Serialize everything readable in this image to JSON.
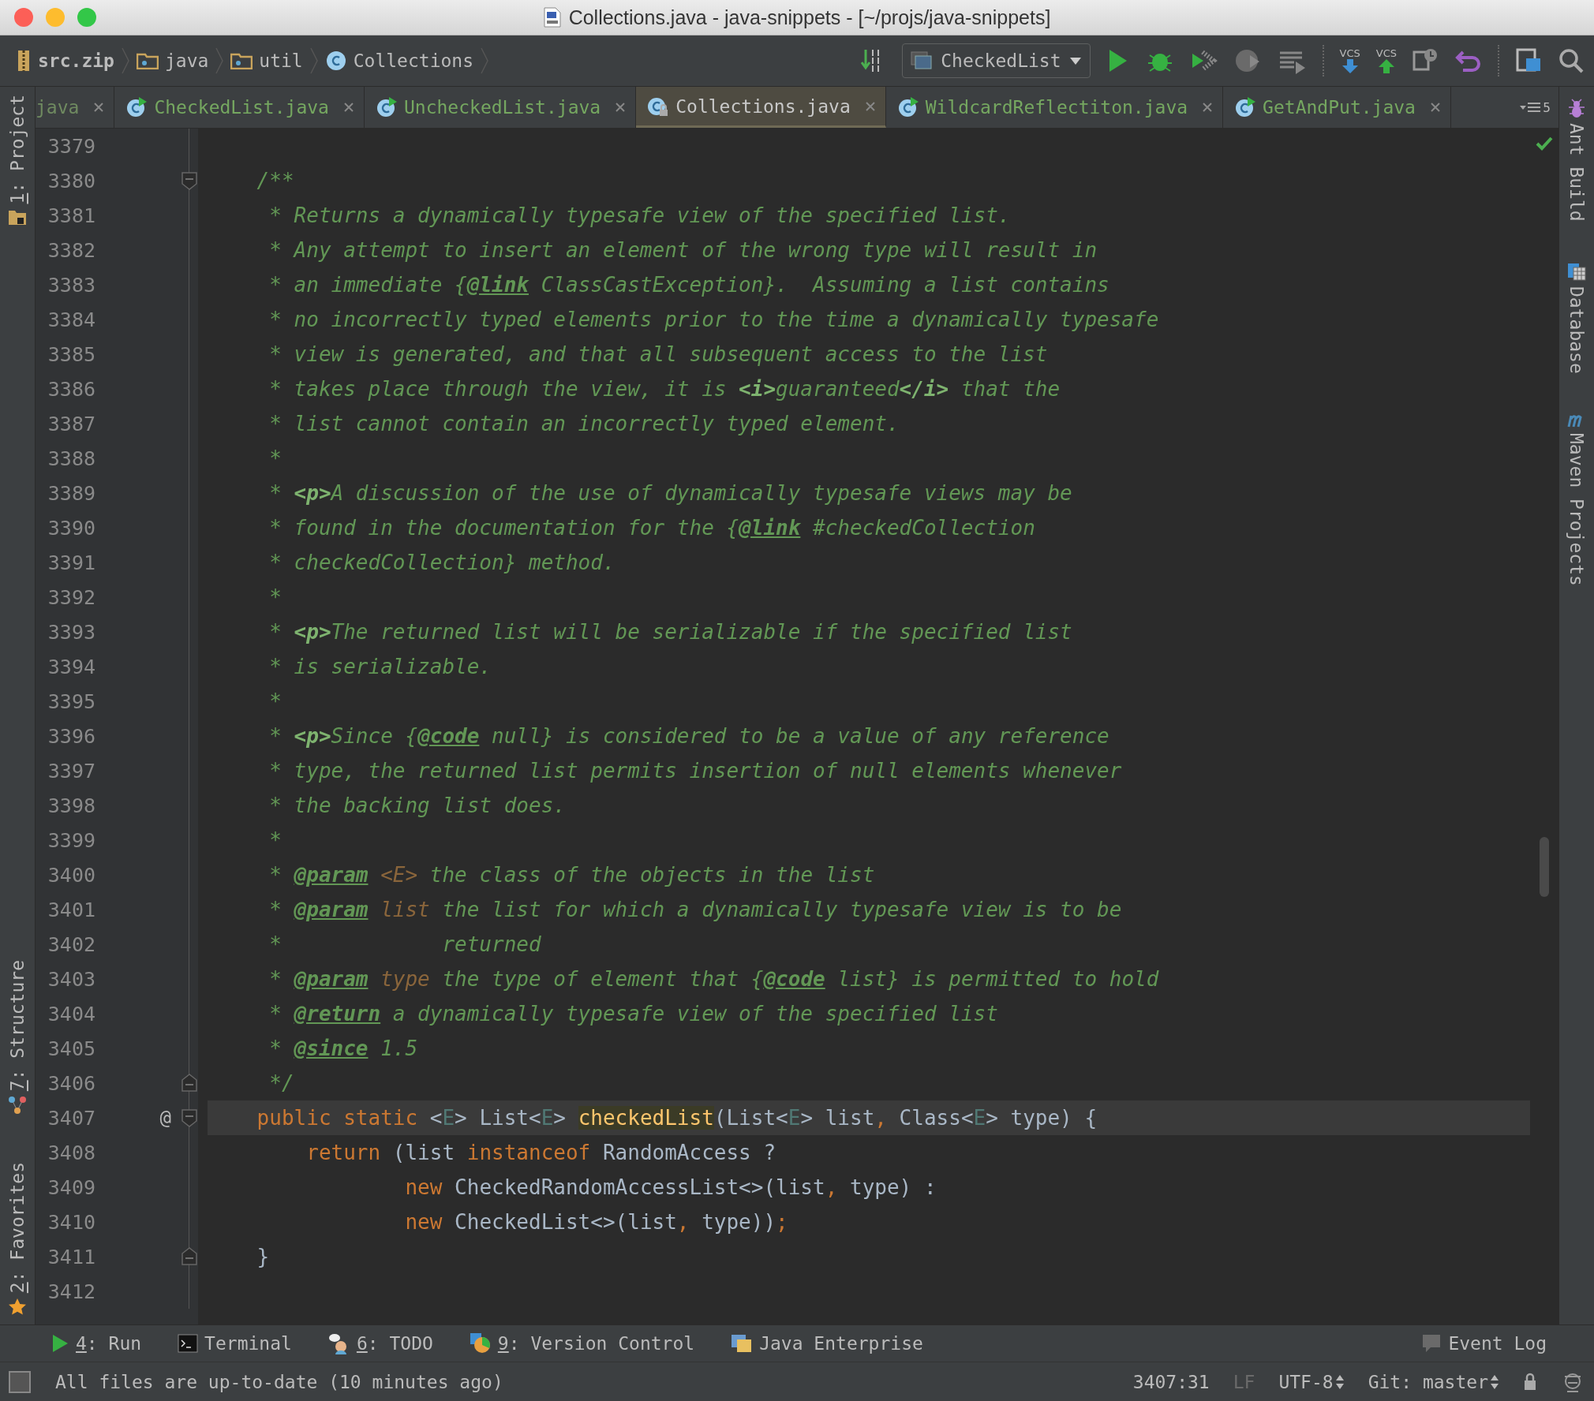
{
  "window": {
    "title": "Collections.java - java-snippets - [~/projs/java-snippets]"
  },
  "breadcrumbs": [
    {
      "label": "src.zip",
      "kind": "archive"
    },
    {
      "label": "java",
      "kind": "folder"
    },
    {
      "label": "util",
      "kind": "folder"
    },
    {
      "label": "Collections",
      "kind": "class"
    }
  ],
  "toolbar": {
    "run_config": "CheckedList",
    "vcs_buttons": [
      {
        "label": "VCS",
        "kind": "update"
      },
      {
        "label": "VCS",
        "kind": "commit"
      }
    ]
  },
  "tabs": [
    {
      "label": "java",
      "selected": false,
      "kind": "plain",
      "color": "#6f8a60"
    },
    {
      "label": "CheckedList.java",
      "selected": false,
      "kind": "runnable",
      "color": "#75a760"
    },
    {
      "label": "UncheckedList.java",
      "selected": false,
      "kind": "runnable",
      "color": "#75a760"
    },
    {
      "label": "Collections.java",
      "selected": true,
      "kind": "locked",
      "color": "#c8c8c8"
    },
    {
      "label": "WildcardReflectiton.java",
      "selected": false,
      "kind": "runnable",
      "color": "#75a760"
    },
    {
      "label": "GetAndPut.java",
      "selected": false,
      "kind": "runnable",
      "color": "#75a760"
    }
  ],
  "tab_overflow_count": "5",
  "left_tool_windows": [
    {
      "label": "1: Project",
      "mnemonic": true,
      "kind": "project"
    },
    {
      "label": "7: Structure",
      "mnemonic": true,
      "kind": "structure"
    },
    {
      "label": "2: Favorites",
      "mnemonic": true,
      "kind": "favorites"
    }
  ],
  "right_tool_windows": [
    {
      "label": "Ant Build",
      "kind": "ant"
    },
    {
      "label": "Database",
      "kind": "database"
    },
    {
      "label": "Maven Projects",
      "kind": "maven"
    }
  ],
  "lines": [
    {
      "number": "3379",
      "current": false,
      "kind": "plain"
    },
    {
      "number": "3380",
      "current": false,
      "kind": "opener",
      "tokens": [
        {
          "kind": "doc",
          "text": "    /**"
        }
      ]
    },
    {
      "number": "3381",
      "current": false,
      "kind": "plain",
      "tokens": [
        {
          "kind": "doc",
          "text": "     * Returns a dynamically typesafe view of the specified list."
        }
      ]
    },
    {
      "number": "3382",
      "current": false,
      "kind": "plain",
      "tokens": [
        {
          "kind": "doc",
          "text": "     * Any attempt to insert an element of the wrong type will result in"
        }
      ]
    },
    {
      "number": "3383",
      "current": false,
      "kind": "plain",
      "tokens": [
        {
          "kind": "doc",
          "text": "     * an immediate {"
        },
        {
          "kind": "tag",
          "text": "@link"
        },
        {
          "kind": "doc",
          "text": " ClassCastException}.  Assuming a list contains"
        }
      ]
    },
    {
      "number": "3384",
      "current": false,
      "kind": "plain",
      "tokens": [
        {
          "kind": "doc",
          "text": "     * no incorrectly typed elements prior to the time a dynamically typesafe"
        }
      ]
    },
    {
      "number": "3385",
      "current": false,
      "kind": "plain",
      "tokens": [
        {
          "kind": "doc",
          "text": "     * view is generated, and that all subsequent access to the list"
        }
      ]
    },
    {
      "number": "3386",
      "current": false,
      "kind": "plain",
      "tokens": [
        {
          "kind": "doc",
          "text": "     * takes place through the view, it is "
        },
        {
          "kind": "html",
          "text": "<i>"
        },
        {
          "kind": "doc",
          "text": "guaranteed"
        },
        {
          "kind": "html",
          "text": "</i>"
        },
        {
          "kind": "doc",
          "text": " that the"
        }
      ]
    },
    {
      "number": "3387",
      "current": false,
      "kind": "plain",
      "tokens": [
        {
          "kind": "doc",
          "text": "     * list cannot contain an incorrectly typed element."
        }
      ]
    },
    {
      "number": "3388",
      "current": false,
      "kind": "plain",
      "tokens": [
        {
          "kind": "doc",
          "text": "     *"
        }
      ]
    },
    {
      "number": "3389",
      "current": false,
      "kind": "plain",
      "tokens": [
        {
          "kind": "doc",
          "text": "     * "
        },
        {
          "kind": "html",
          "text": "<p>"
        },
        {
          "kind": "doc",
          "text": "A discussion of the use of dynamically typesafe views may be"
        }
      ]
    },
    {
      "number": "3390",
      "current": false,
      "kind": "plain",
      "tokens": [
        {
          "kind": "doc",
          "text": "     * found in the documentation for the {"
        },
        {
          "kind": "tag",
          "text": "@link"
        },
        {
          "kind": "doc",
          "text": " #checkedCollection"
        }
      ]
    },
    {
      "number": "3391",
      "current": false,
      "kind": "plain",
      "tokens": [
        {
          "kind": "doc",
          "text": "     * checkedCollection} method."
        }
      ]
    },
    {
      "number": "3392",
      "current": false,
      "kind": "plain",
      "tokens": [
        {
          "kind": "doc",
          "text": "     *"
        }
      ]
    },
    {
      "number": "3393",
      "current": false,
      "kind": "plain",
      "tokens": [
        {
          "kind": "doc",
          "text": "     * "
        },
        {
          "kind": "html",
          "text": "<p>"
        },
        {
          "kind": "doc",
          "text": "The returned list will be serializable if the specified list"
        }
      ]
    },
    {
      "number": "3394",
      "current": false,
      "kind": "plain",
      "tokens": [
        {
          "kind": "doc",
          "text": "     * is serializable."
        }
      ]
    },
    {
      "number": "3395",
      "current": false,
      "kind": "plain",
      "tokens": [
        {
          "kind": "doc",
          "text": "     *"
        }
      ]
    },
    {
      "number": "3396",
      "current": false,
      "kind": "plain",
      "tokens": [
        {
          "kind": "doc",
          "text": "     * "
        },
        {
          "kind": "html",
          "text": "<p>"
        },
        {
          "kind": "doc",
          "text": "Since {"
        },
        {
          "kind": "tag",
          "text": "@code"
        },
        {
          "kind": "doc",
          "text": " null} is considered to be a value of any reference"
        }
      ]
    },
    {
      "number": "3397",
      "current": false,
      "kind": "plain",
      "tokens": [
        {
          "kind": "doc",
          "text": "     * type, the returned list permits insertion of null elements whenever"
        }
      ]
    },
    {
      "number": "3398",
      "current": false,
      "kind": "plain",
      "tokens": [
        {
          "kind": "doc",
          "text": "     * the backing list does."
        }
      ]
    },
    {
      "number": "3399",
      "current": false,
      "kind": "plain",
      "tokens": [
        {
          "kind": "doc",
          "text": "     *"
        }
      ]
    },
    {
      "number": "3400",
      "current": false,
      "kind": "plain",
      "tokens": [
        {
          "kind": "doc",
          "text": "     * "
        },
        {
          "kind": "tag",
          "text": "@param"
        },
        {
          "kind": "param",
          "text": " <E>"
        },
        {
          "kind": "doc",
          "text": " the class of the objects in the list"
        }
      ]
    },
    {
      "number": "3401",
      "current": false,
      "kind": "plain",
      "tokens": [
        {
          "kind": "doc",
          "text": "     * "
        },
        {
          "kind": "tag",
          "text": "@param"
        },
        {
          "kind": "param",
          "text": " list"
        },
        {
          "kind": "doc",
          "text": " the list for which a dynamically typesafe view is to be"
        }
      ]
    },
    {
      "number": "3402",
      "current": false,
      "kind": "plain",
      "tokens": [
        {
          "kind": "doc",
          "text": "     *             returned"
        }
      ]
    },
    {
      "number": "3403",
      "current": false,
      "kind": "plain",
      "tokens": [
        {
          "kind": "doc",
          "text": "     * "
        },
        {
          "kind": "tag",
          "text": "@param"
        },
        {
          "kind": "param",
          "text": " type"
        },
        {
          "kind": "doc",
          "text": " the type of element that {"
        },
        {
          "kind": "tag",
          "text": "@code"
        },
        {
          "kind": "doc",
          "text": " list} is permitted to hold"
        }
      ]
    },
    {
      "number": "3404",
      "current": false,
      "kind": "plain",
      "tokens": [
        {
          "kind": "doc",
          "text": "     * "
        },
        {
          "kind": "tag",
          "text": "@return"
        },
        {
          "kind": "doc",
          "text": " a dynamically typesafe view of the specified list"
        }
      ]
    },
    {
      "number": "3405",
      "current": false,
      "kind": "plain",
      "tokens": [
        {
          "kind": "doc",
          "text": "     * "
        },
        {
          "kind": "tag",
          "text": "@since"
        },
        {
          "kind": "doc",
          "text": " 1.5"
        }
      ]
    },
    {
      "number": "3406",
      "current": false,
      "kind": "closer",
      "tokens": [
        {
          "kind": "doc",
          "text": "     */"
        }
      ]
    },
    {
      "number": "3407",
      "current": true,
      "kind": "opener",
      "gutter_mark": "@",
      "tokens": [
        {
          "kind": "kw",
          "text": "    public static "
        },
        {
          "kind": "plain",
          "text": "<"
        },
        {
          "kind": "tp",
          "text": "E"
        },
        {
          "kind": "plain",
          "text": "> List<"
        },
        {
          "kind": "tp",
          "text": "E"
        },
        {
          "kind": "plain",
          "text": "> "
        },
        {
          "kind": "method",
          "text": "checkedList"
        },
        {
          "kind": "plain",
          "text": "(List<"
        },
        {
          "kind": "tp",
          "text": "E"
        },
        {
          "kind": "plain",
          "text": "> list"
        },
        {
          "kind": "kw",
          "text": ","
        },
        {
          "kind": "plain",
          "text": " Class<"
        },
        {
          "kind": "tp",
          "text": "E"
        },
        {
          "kind": "plain",
          "text": "> type) {"
        }
      ]
    },
    {
      "number": "3408",
      "current": false,
      "kind": "plain",
      "tokens": [
        {
          "kind": "kw",
          "text": "        return "
        },
        {
          "kind": "plain",
          "text": "(list "
        },
        {
          "kind": "kw",
          "text": "instanceof "
        },
        {
          "kind": "plain",
          "text": "RandomAccess ?"
        }
      ]
    },
    {
      "number": "3409",
      "current": false,
      "kind": "plain",
      "tokens": [
        {
          "kind": "kw",
          "text": "                new "
        },
        {
          "kind": "plain",
          "text": "CheckedRandomAccessList<>(list"
        },
        {
          "kind": "kw",
          "text": ","
        },
        {
          "kind": "plain",
          "text": " type) :"
        }
      ]
    },
    {
      "number": "3410",
      "current": false,
      "kind": "plain",
      "tokens": [
        {
          "kind": "kw",
          "text": "                new "
        },
        {
          "kind": "plain",
          "text": "CheckedList<>(list"
        },
        {
          "kind": "kw",
          "text": ","
        },
        {
          "kind": "plain",
          "text": " type))"
        },
        {
          "kind": "kw",
          "text": ";"
        }
      ]
    },
    {
      "number": "3411",
      "current": false,
      "kind": "closer",
      "tokens": [
        {
          "kind": "plain",
          "text": "    }"
        }
      ]
    },
    {
      "number": "3412",
      "current": false,
      "kind": "plain"
    }
  ],
  "bottom_tool_windows": [
    {
      "label": "4: Run",
      "mnemonic": true,
      "kind": "run"
    },
    {
      "label": "Terminal",
      "mnemonic": false,
      "kind": "terminal"
    },
    {
      "label": "6: TODO",
      "mnemonic": true,
      "kind": "todo"
    },
    {
      "label": "9: Version Control",
      "mnemonic": true,
      "kind": "vcs"
    },
    {
      "label": "Java Enterprise",
      "mnemonic": false,
      "kind": "enterprise"
    }
  ],
  "event_log": "Event Log",
  "status_bar": {
    "message": "All files are up-to-date (10 minutes ago)",
    "items": [
      {
        "label": "3407:31",
        "kind": "plain"
      },
      {
        "label": "LF",
        "kind": "disabled"
      },
      {
        "label": "UTF-8",
        "kind": "dropdown"
      },
      {
        "label": "Git: master",
        "kind": "dropdown"
      }
    ]
  }
}
